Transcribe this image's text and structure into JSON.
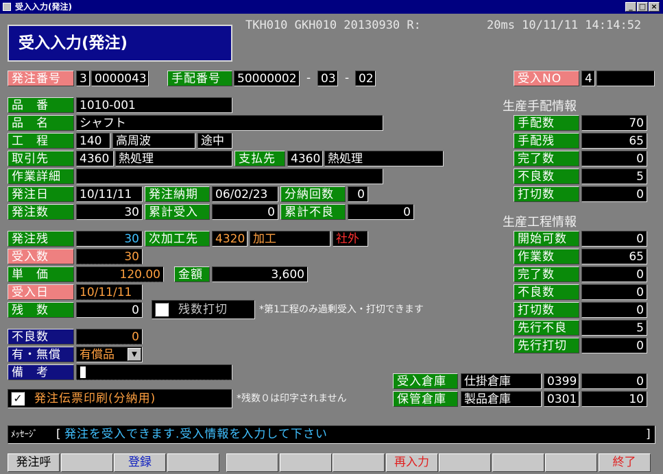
{
  "window": {
    "title": "受入入力(発注)",
    "controls": [
      "_",
      "□",
      "×"
    ]
  },
  "header": {
    "title": "受入入力(発注)",
    "sysinfo": "TKH010 GKH010 20130930 R:",
    "timing": "20ms 10/11/11 14:14:52"
  },
  "order_line": {
    "hatchu_no_label": "発注番号",
    "hatchu_prefix": "3",
    "hatchu_no": "0000043",
    "tehai_no_label": "手配番号",
    "tehai_no": "50000002",
    "tehai_sep1": "-",
    "tehai_sub1": "03",
    "tehai_sep2": "-",
    "tehai_sub2": "02",
    "ukeire_no_label": "受入NO",
    "ukeire_no": "4",
    "ukeire_extra": ""
  },
  "item": {
    "hinban_label": "品　番",
    "hinban": "1010-001",
    "hinmei_label": "品　名",
    "hinmei": "シャフト",
    "kotei_label": "工　程",
    "kotei_code": "140",
    "kotei_name": "高周波",
    "kotei_status": "途中",
    "torihiki_label": "取引先",
    "torihiki_code": "4360",
    "torihiki_name": "熱処理",
    "shiharai_label": "支払先",
    "shiharai_code": "4360",
    "shiharai_name": "熱処理",
    "sagyo_label": "作業詳細",
    "sagyo": "",
    "hatchubi_label": "発注日",
    "hatchubi": "10/11/11",
    "nouki_label": "発注納期",
    "nouki": "06/02/23",
    "bunno_label": "分納回数",
    "bunno": "0",
    "hatchusu_label": "発注数",
    "hatchusu": "30",
    "ruikei_uke_label": "累計受入",
    "ruikei_uke": "0",
    "ruikei_furyo_label": "累計不良",
    "ruikei_furyo": "0"
  },
  "receive": {
    "zan_label": "発注残",
    "zan": "30",
    "jikako_label": "次加工先",
    "jikako_code": "4320",
    "jikako_name": "加工",
    "jikako_flag": "社外",
    "ukesu_label": "受入数",
    "ukesu": "30",
    "tanka_label": "単　価",
    "tanka": "120.00",
    "kingaku_label": "金額",
    "kingaku": "3,600",
    "ukebi_label": "受入日",
    "ukebi": "10/11/11",
    "zansu_label": "残　数",
    "zansu": "0",
    "zansu_uchikiri_label": "残数打切",
    "note1": "*第1工程のみ過剰受入・打切できます",
    "furyo_label": "不良数",
    "furyo": "0",
    "yumu_label": "有・無償",
    "yumu": "有償品",
    "biko_label": "備　考",
    "biko": "",
    "print_label": "発注伝票印刷(分納用)",
    "print_check": "✓",
    "note2": "*残数０は印字されません"
  },
  "seisan_tehai": {
    "title": "生産手配情報",
    "rows": [
      {
        "label": "手配数",
        "value": "70"
      },
      {
        "label": "手配残",
        "value": "65"
      },
      {
        "label": "完了数",
        "value": "0"
      },
      {
        "label": "不良数",
        "value": "5"
      },
      {
        "label": "打切数",
        "value": "0"
      }
    ]
  },
  "seisan_kotei": {
    "title": "生産工程情報",
    "rows": [
      {
        "label": "開始可数",
        "value": "0"
      },
      {
        "label": "作業数",
        "value": "65"
      },
      {
        "label": "完了数",
        "value": "0"
      },
      {
        "label": "不良数",
        "value": "0"
      },
      {
        "label": "打切数",
        "value": "0"
      },
      {
        "label": "先行不良",
        "value": "5"
      },
      {
        "label": "先行打切",
        "value": "0"
      }
    ]
  },
  "warehouse": {
    "ukeire_label": "受入倉庫",
    "ukeire_name": "仕掛倉庫",
    "ukeire_code": "0399",
    "ukeire_qty": "0",
    "hokan_label": "保管倉庫",
    "hokan_name": "製品倉庫",
    "hokan_code": "0301",
    "hokan_qty": "10"
  },
  "message": {
    "label": "ﾒｯｾｰｼﾞ",
    "open": "[",
    "text": "発注を受入できます.受入情報を入力して下さい",
    "close": "]"
  },
  "fkeys": [
    "発注呼",
    "",
    "登録",
    "",
    "",
    "",
    "",
    "再入力",
    "",
    "",
    "",
    "終了"
  ],
  "colors": {
    "label_green": "#0a8a0a",
    "label_pink": "#ee8080",
    "label_navy": "#101080",
    "value_bg": "#000000",
    "cyan": "#40c0ff",
    "orange": "#ffa040",
    "red": "#ff3030"
  }
}
